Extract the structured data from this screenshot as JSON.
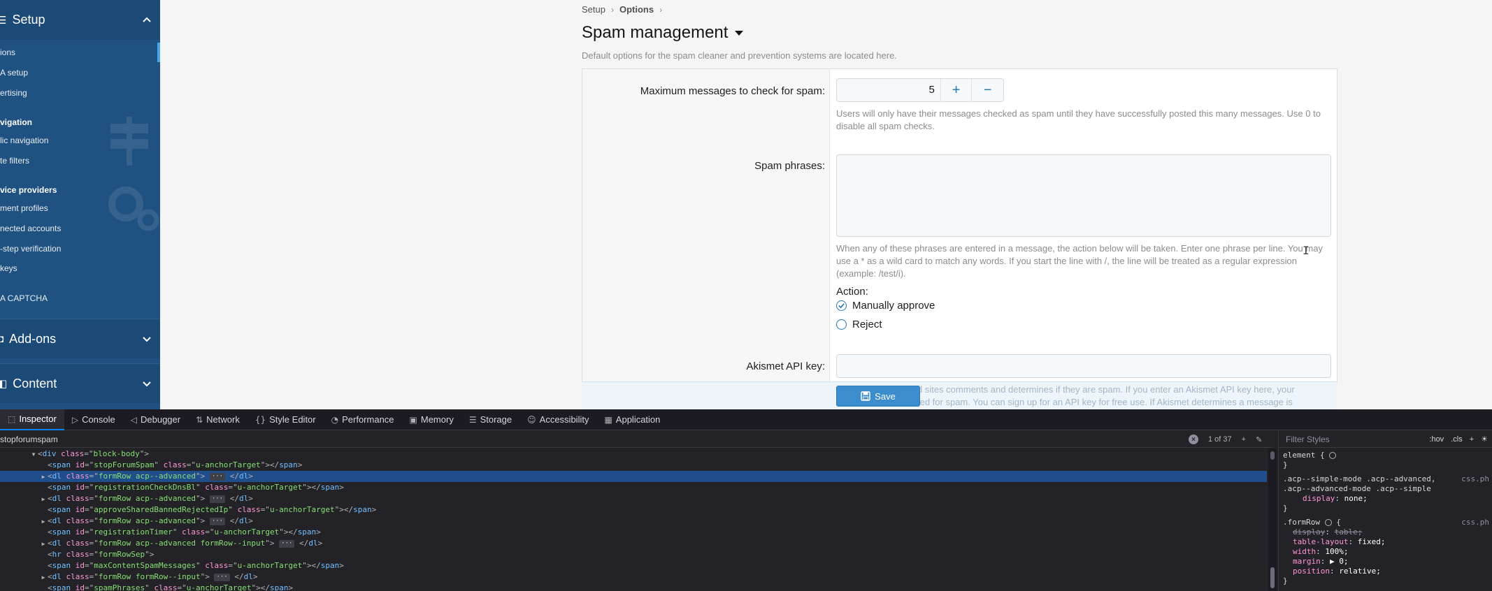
{
  "sidebar": {
    "setup_title": "Setup",
    "setup_icon": "list-icon",
    "items": [
      {
        "label": "ions"
      },
      {
        "label": "A setup"
      },
      {
        "label": "ertising"
      },
      {
        "label": "lic navigation"
      },
      {
        "label": "te filters"
      },
      {
        "label": "ment profiles"
      },
      {
        "label": "nected accounts"
      },
      {
        "label": "-step verification"
      },
      {
        "label": "keys"
      },
      {
        "label": "A CAPTCHA"
      }
    ],
    "groups": [
      {
        "label": "vigation"
      },
      {
        "label": "vice providers"
      }
    ],
    "addons_title": "Add-ons",
    "content_title": "Content"
  },
  "breadcrumb": {
    "parent": "Setup",
    "current": "Options",
    "sep": "›"
  },
  "page": {
    "title": "Spam management",
    "description": "Default options for the spam cleaner and prevention systems are located here."
  },
  "form": {
    "max_messages": {
      "label": "Maximum messages to check for spam:",
      "value": "5",
      "plus": "+",
      "minus": "−",
      "hint": "Users will only have their messages checked as spam until they have successfully posted this many messages. Use 0 to disable all spam checks."
    },
    "spam_phrases": {
      "label": "Spam phrases:",
      "value": "",
      "hint": "When any of these phrases are entered in a message, the action below will be taken. Enter one phrase per line. You may use a * as a wild card to match any words. If you start the line with /, the line will be treated as a regular expression (example: /test/i).",
      "action_label": "Action:",
      "options": [
        {
          "label": "Manually approve",
          "checked": true
        },
        {
          "label": "Reject",
          "checked": false
        }
      ]
    },
    "akismet": {
      "label": "Akismet API key:",
      "value": "",
      "ghost_hint_1": "d sites comments and determines if they are spam. If you enter an Akismet API key here, your",
      "ghost_hint_2": "ted for spam. You can sign up for an API key for free use. If Akismet determines a message is"
    },
    "save_label": "Save"
  },
  "devtools": {
    "tabs": [
      {
        "label": "Inspector",
        "icon": "inspector-icon",
        "active": true
      },
      {
        "label": "Console",
        "icon": "console-icon"
      },
      {
        "label": "Debugger",
        "icon": "debugger-icon"
      },
      {
        "label": "Network",
        "icon": "network-icon"
      },
      {
        "label": "Style Editor",
        "icon": "style-editor-icon"
      },
      {
        "label": "Performance",
        "icon": "performance-icon"
      },
      {
        "label": "Memory",
        "icon": "memory-icon"
      },
      {
        "label": "Storage",
        "icon": "storage-icon"
      },
      {
        "label": "Accessibility",
        "icon": "accessibility-icon"
      },
      {
        "label": "Application",
        "icon": "application-icon"
      }
    ],
    "search_value": "stopforumspam",
    "match_count": "1 of 37",
    "filter_placeholder": "Filter Styles",
    "hov": ":hov",
    "cls": ".cls",
    "markup": [
      {
        "indent": 4,
        "twisty": "▼",
        "open": "div",
        "attrs": [
          [
            "class",
            "block-body"
          ]
        ],
        "close": false,
        "tail": ""
      },
      {
        "indent": 5,
        "twisty": "",
        "open": "span",
        "attrs": [
          [
            "id",
            "stopForumSpam"
          ],
          [
            "class",
            "u-anchorTarget"
          ]
        ],
        "close": true,
        "tail": ""
      },
      {
        "indent": 5,
        "twisty": "▶",
        "open": "dl",
        "attrs": [
          [
            "class",
            "formRow acp--advanced"
          ]
        ],
        "ell": true,
        "closetag": "dl",
        "selected": true
      },
      {
        "indent": 5,
        "twisty": "",
        "open": "span",
        "attrs": [
          [
            "id",
            "registrationCheckDnsBl"
          ],
          [
            "class",
            "u-anchorTarget"
          ]
        ],
        "close": true
      },
      {
        "indent": 5,
        "twisty": "▶",
        "open": "dl",
        "attrs": [
          [
            "class",
            "formRow acp--advanced"
          ]
        ],
        "ell": true,
        "closetag": "dl"
      },
      {
        "indent": 5,
        "twisty": "",
        "open": "span",
        "attrs": [
          [
            "id",
            "approveSharedBannedRejectedIp"
          ],
          [
            "class",
            "u-anchorTarget"
          ]
        ],
        "close": true
      },
      {
        "indent": 5,
        "twisty": "▶",
        "open": "dl",
        "attrs": [
          [
            "class",
            "formRow acp--advanced"
          ]
        ],
        "ell": true,
        "closetag": "dl"
      },
      {
        "indent": 5,
        "twisty": "",
        "open": "span",
        "attrs": [
          [
            "id",
            "registrationTimer"
          ],
          [
            "class",
            "u-anchorTarget"
          ]
        ],
        "close": true
      },
      {
        "indent": 5,
        "twisty": "▶",
        "open": "dl",
        "attrs": [
          [
            "class",
            "formRow acp--advanced formRow--input"
          ]
        ],
        "ell": true,
        "closetag": "dl"
      },
      {
        "indent": 5,
        "twisty": "",
        "open": "hr",
        "attrs": [
          [
            "class",
            "formRowSep"
          ]
        ],
        "void": true
      },
      {
        "indent": 5,
        "twisty": "",
        "open": "span",
        "attrs": [
          [
            "id",
            "maxContentSpamMessages"
          ],
          [
            "class",
            "u-anchorTarget"
          ]
        ],
        "close": true
      },
      {
        "indent": 5,
        "twisty": "▶",
        "open": "dl",
        "attrs": [
          [
            "class",
            "formRow formRow--input"
          ]
        ],
        "ell": true,
        "closetag": "dl"
      },
      {
        "indent": 5,
        "twisty": "",
        "open": "span",
        "attrs": [
          [
            "id",
            "spamPhrases"
          ],
          [
            "class",
            "u-anchorTarget"
          ]
        ],
        "close": true
      }
    ],
    "rules": {
      "element": "element {",
      "rule1_sel": ".acp--simple-mode .acp--advanced, .acp--advanced-mode .acp--simple",
      "rule1_src": "css.ph",
      "rule1_decls": [
        {
          "p": "display",
          "v": "none;"
        }
      ],
      "rule2_sel": ".formRow",
      "rule2_src": "css.ph",
      "rule2_decls": [
        {
          "p": "display",
          "v": "table;",
          "strike": true
        },
        {
          "p": "table-layout",
          "v": "fixed;"
        },
        {
          "p": "width",
          "v": "100%;"
        },
        {
          "p": "margin",
          "v": "▶ 0;"
        },
        {
          "p": "position",
          "v": "relative;"
        }
      ]
    }
  }
}
